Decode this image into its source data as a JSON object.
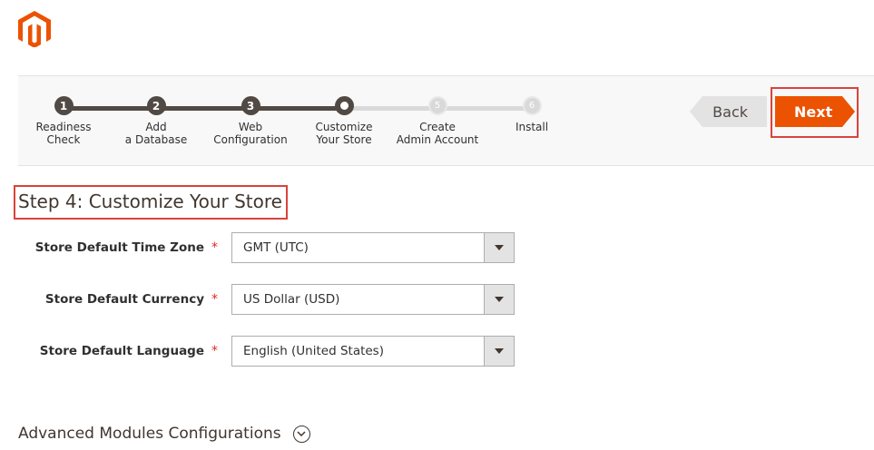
{
  "brand": {
    "logo": "magento-logo-icon",
    "accent": "#eb5202"
  },
  "wizard": {
    "steps": [
      {
        "number": "1",
        "label_line1": "Readiness",
        "label_line2": "Check",
        "state": "done"
      },
      {
        "number": "2",
        "label_line1": "Add",
        "label_line2": "a Database",
        "state": "done"
      },
      {
        "number": "3",
        "label_line1": "Web",
        "label_line2": "Configuration",
        "state": "done"
      },
      {
        "number": "4",
        "label_line1": "Customize",
        "label_line2": "Your Store",
        "state": "current"
      },
      {
        "number": "5",
        "label_line1": "Create",
        "label_line2": "Admin Account",
        "state": "todo"
      },
      {
        "number": "6",
        "label_line1": "Install",
        "label_line2": "",
        "state": "todo"
      }
    ],
    "back_label": "Back",
    "next_label": "Next"
  },
  "page": {
    "title": "Step 4: Customize Your Store"
  },
  "fields": [
    {
      "label": "Store Default Time Zone",
      "required_mark": "*",
      "value": "GMT (UTC)"
    },
    {
      "label": "Store Default Currency",
      "required_mark": "*",
      "value": "US Dollar (USD)"
    },
    {
      "label": "Store Default Language",
      "required_mark": "*",
      "value": "English (United States)"
    }
  ],
  "advanced": {
    "label": "Advanced Modules Configurations",
    "toggle_icon": "chevron-down-circle-icon"
  }
}
